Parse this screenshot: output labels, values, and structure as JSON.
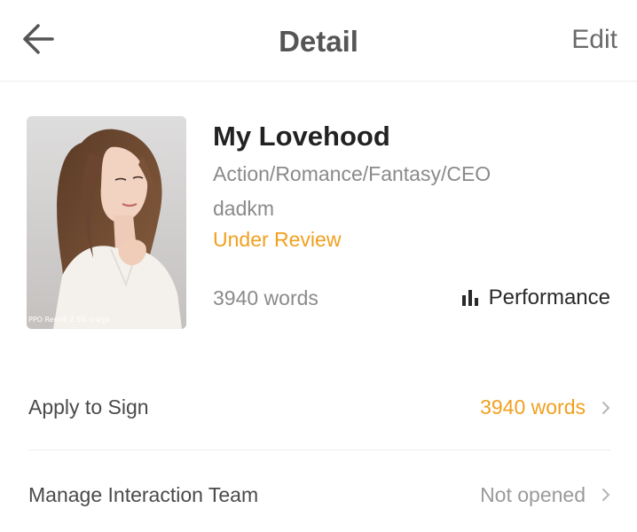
{
  "header": {
    "title": "Detail",
    "edit_label": "Edit"
  },
  "book": {
    "title": "My Lovehood",
    "genres": "Action/Romance/Fantasy/CEO",
    "author": "dadkm",
    "status": "Under Review",
    "word_count": "3940 words",
    "performance_label": "Performance",
    "cover_watermark": "PPO Reno6 Z 5G ถ่ายรูป"
  },
  "rows": [
    {
      "label": "Apply to Sign",
      "value": "3940 words"
    },
    {
      "label": "Manage Interaction Team",
      "value": "Not opened"
    }
  ],
  "colors": {
    "accent": "#f0a020",
    "title_text": "#222222",
    "muted_text": "#8a8a8a",
    "divider": "#eeeeee"
  },
  "icons": {
    "back": "arrow-left-icon",
    "performance": "bar-chart-icon",
    "row_arrow": "chevron-right-icon"
  }
}
